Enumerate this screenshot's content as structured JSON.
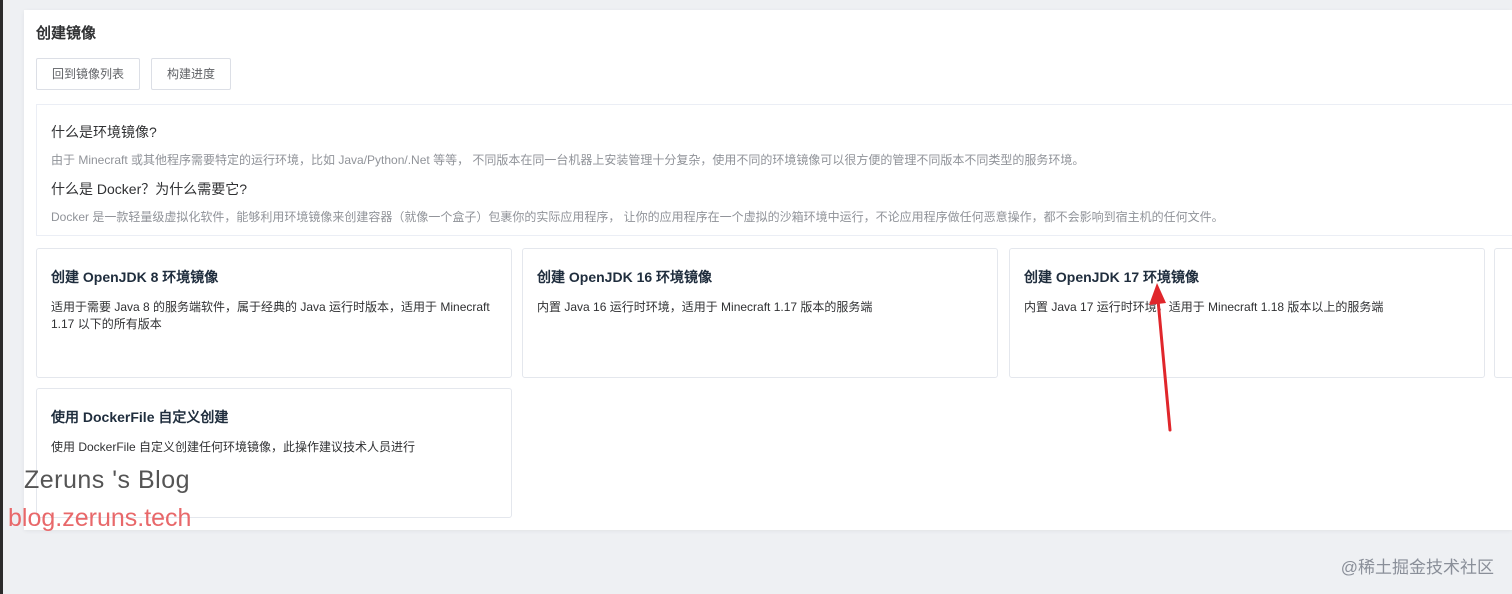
{
  "page_title": "创建镜像",
  "toolbar": {
    "back_label": "回到镜像列表",
    "progress_label": "构建进度"
  },
  "info": {
    "q1": "什么是环境镜像?",
    "a1": "由于 Minecraft 或其他程序需要特定的运行环境，比如 Java/Python/.Net 等等， 不同版本在同一台机器上安装管理十分复杂，使用不同的环境镜像可以很方便的管理不同版本不同类型的服务环境。",
    "q2": "什么是 Docker？为什么需要它?",
    "a2": "Docker 是一款轻量级虚拟化软件，能够利用环境镜像来创建容器（就像一个盒子）包裹你的实际应用程序， 让你的应用程序在一个虚拟的沙箱环境中运行，不论应用程序做任何恶意操作，都不会影响到宿主机的任何文件。"
  },
  "cards": [
    {
      "title": "创建 OpenJDK 8 环境镜像",
      "desc": "适用于需要 Java 8 的服务端软件，属于经典的 Java 运行时版本，适用于 Minecraft 1.17 以下的所有版本"
    },
    {
      "title": "创建 OpenJDK 16 环境镜像",
      "desc": "内置 Java 16 运行时环境，适用于 Minecraft 1.17 版本的服务端"
    },
    {
      "title": "创建 OpenJDK 17 环境镜像",
      "desc": "内置 Java 17 运行时环境，适用于 Minecraft 1.18 版本以上的服务端"
    },
    {
      "title": "使用 DockerFile 自定义创建",
      "desc": "使用 DockerFile 自定义创建任何环境镜像，此操作建议技术人员进行"
    }
  ],
  "watermark": {
    "blog_name": "Zeruns 's Blog",
    "blog_url": "blog.zeruns.tech",
    "juejin": "@稀土掘金技术社区"
  },
  "colors": {
    "arrow": "#e0262b",
    "watermark_url": "#e8686a"
  }
}
